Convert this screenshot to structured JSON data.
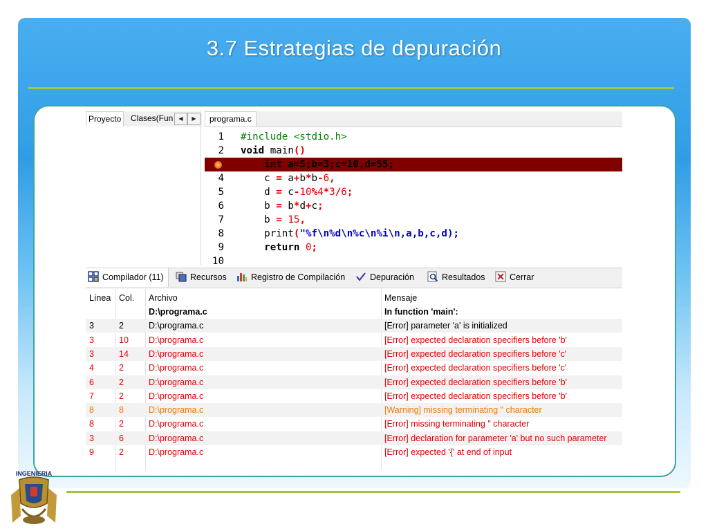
{
  "slide": {
    "title": "3.7  Estrategias de depuración",
    "logo_text": "INGENIERIA"
  },
  "ide": {
    "left_tabs": [
      "Proyecto",
      "Clases(Fun"
    ],
    "editor_tab": "programa.c",
    "code": [
      {
        "n": "1",
        "parts": [
          [
            "inc",
            "#include <stdio.h>"
          ]
        ]
      },
      {
        "n": "2",
        "parts": [
          [
            "kw",
            "void"
          ],
          [
            "plain",
            " main"
          ],
          [
            "op",
            "()"
          ]
        ]
      },
      {
        "n": "3",
        "error": true,
        "parts": [
          [
            "plain",
            "    int a=5;b=3;c=10,d=55;"
          ]
        ]
      },
      {
        "n": "4",
        "parts": [
          [
            "plain",
            "    c "
          ],
          [
            "op",
            "="
          ],
          [
            "plain",
            " a"
          ],
          [
            "op",
            "+"
          ],
          [
            "plain",
            "b"
          ],
          [
            "op",
            "*"
          ],
          [
            "plain",
            "b"
          ],
          [
            "op",
            "-"
          ],
          [
            "num",
            "6"
          ],
          [
            "op",
            ","
          ]
        ]
      },
      {
        "n": "5",
        "parts": [
          [
            "plain",
            "    d "
          ],
          [
            "op",
            "="
          ],
          [
            "plain",
            " c"
          ],
          [
            "op",
            "-"
          ],
          [
            "num",
            "10"
          ],
          [
            "op",
            "%"
          ],
          [
            "num",
            "4"
          ],
          [
            "op",
            "*"
          ],
          [
            "num",
            "3"
          ],
          [
            "op",
            "/"
          ],
          [
            "num",
            "6"
          ],
          [
            "op",
            ";"
          ]
        ]
      },
      {
        "n": "6",
        "parts": [
          [
            "plain",
            "    b "
          ],
          [
            "op",
            "="
          ],
          [
            "plain",
            " b"
          ],
          [
            "op",
            "*"
          ],
          [
            "plain",
            "d"
          ],
          [
            "op",
            "+"
          ],
          [
            "plain",
            "c"
          ],
          [
            "op",
            ";"
          ]
        ]
      },
      {
        "n": "7",
        "parts": [
          [
            "plain",
            "    b "
          ],
          [
            "op",
            "="
          ],
          [
            "plain",
            " "
          ],
          [
            "num",
            "15"
          ],
          [
            "op",
            ","
          ]
        ]
      },
      {
        "n": "8",
        "parts": [
          [
            "plain",
            "    print"
          ],
          [
            "op",
            "("
          ],
          [
            "str",
            "\"%f\\n%d\\n%c\\n%i\\n,a,b,c,d);"
          ]
        ]
      },
      {
        "n": "9",
        "parts": [
          [
            "plain",
            "    "
          ],
          [
            "kw",
            "return"
          ],
          [
            "plain",
            " "
          ],
          [
            "num",
            "0"
          ],
          [
            "op",
            ";"
          ]
        ]
      },
      {
        "n": "10",
        "parts": []
      }
    ],
    "bottom_tabs": [
      {
        "id": "compilador",
        "label": "Compilador (11)",
        "icon": "grid-icon"
      },
      {
        "id": "recursos",
        "label": "Recursos",
        "icon": "resources-icon"
      },
      {
        "id": "registro",
        "label": "Registro de Compilación",
        "icon": "bar-chart-icon"
      },
      {
        "id": "depuracion",
        "label": "Depuración",
        "icon": "checkmark-icon"
      },
      {
        "id": "resultados",
        "label": "Resultados",
        "icon": "magnifier-icon"
      },
      {
        "id": "cerrar",
        "label": "Cerrar",
        "icon": "close-icon"
      }
    ],
    "table": {
      "headers": {
        "linea": "Línea",
        "col": "Col.",
        "archivo": "Archivo",
        "mensaje": "Mensaje"
      },
      "rows": [
        {
          "linea": "",
          "col": "",
          "archivo": "D:\\programa.c",
          "mensaje": "In function 'main':",
          "severity": "bold"
        },
        {
          "linea": "3",
          "col": "2",
          "archivo": "D:\\programa.c",
          "mensaje": "[Error] parameter 'a' is initialized",
          "severity": "plain"
        },
        {
          "linea": "3",
          "col": "10",
          "archivo": "D:\\programa.c",
          "mensaje": "[Error] expected declaration specifiers before 'b'",
          "severity": "error"
        },
        {
          "linea": "3",
          "col": "14",
          "archivo": "D:\\programa.c",
          "mensaje": "[Error] expected declaration specifiers before 'c'",
          "severity": "error"
        },
        {
          "linea": "4",
          "col": "2",
          "archivo": "D:\\programa.c",
          "mensaje": "[Error] expected declaration specifiers before 'c'",
          "severity": "error"
        },
        {
          "linea": "6",
          "col": "2",
          "archivo": "D:\\programa.c",
          "mensaje": "[Error] expected declaration specifiers before 'b'",
          "severity": "error"
        },
        {
          "linea": "7",
          "col": "2",
          "archivo": "D:\\programa.c",
          "mensaje": "[Error] expected declaration specifiers before 'b'",
          "severity": "error"
        },
        {
          "linea": "8",
          "col": "8",
          "archivo": "D:\\programa.c",
          "mensaje": "[Warning] missing terminating \" character",
          "severity": "warning"
        },
        {
          "linea": "8",
          "col": "2",
          "archivo": "D:\\programa.c",
          "mensaje": "[Error] missing terminating \" character",
          "severity": "error"
        },
        {
          "linea": "3",
          "col": "6",
          "archivo": "D:\\programa.c",
          "mensaje": "[Error] declaration for parameter 'a' but no such parameter",
          "severity": "error"
        },
        {
          "linea": "9",
          "col": "2",
          "archivo": "D:\\programa.c",
          "mensaje": "[Error] expected '{' at end of input",
          "severity": "error"
        }
      ]
    }
  },
  "colors": {
    "header_blue": "#2f9de6",
    "rule_green": "#9dc73d",
    "card_border": "#3aa5a0",
    "error_line_bg": "#800000",
    "error_text": "#e00000",
    "warning_text": "#f07800"
  }
}
